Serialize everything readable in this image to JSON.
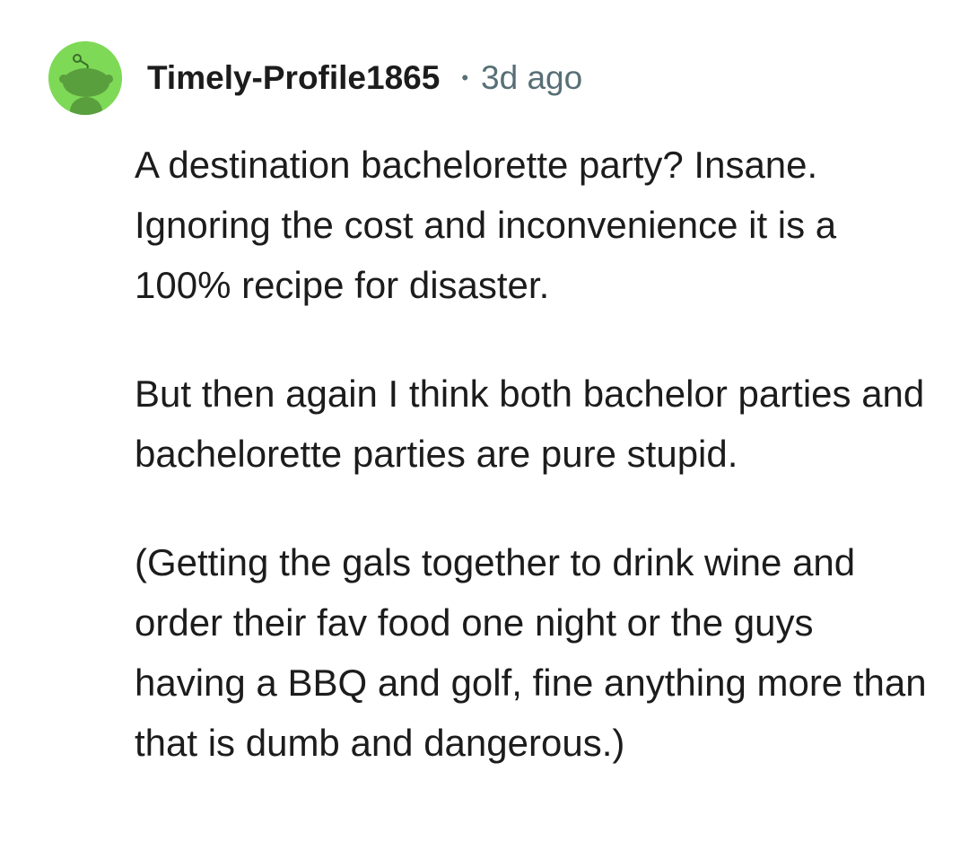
{
  "comment": {
    "author": "Timely-Profile1865",
    "separator": "•",
    "timestamp": "3d ago",
    "avatar_icon": "snoo-avatar-icon",
    "avatar_color": "#7ed957",
    "paragraphs": [
      "A destination bachelorette party? Insane. Ignoring the cost and inconvenience it is a 100% recipe for disaster.",
      "But then again I think both bachelor parties and bachelorette parties are pure stupid.",
      "(Getting the gals together to drink wine and order their fav food one night or the guys having a BBQ and golf, fine anything more than that is dumb and dangerous.)"
    ]
  }
}
